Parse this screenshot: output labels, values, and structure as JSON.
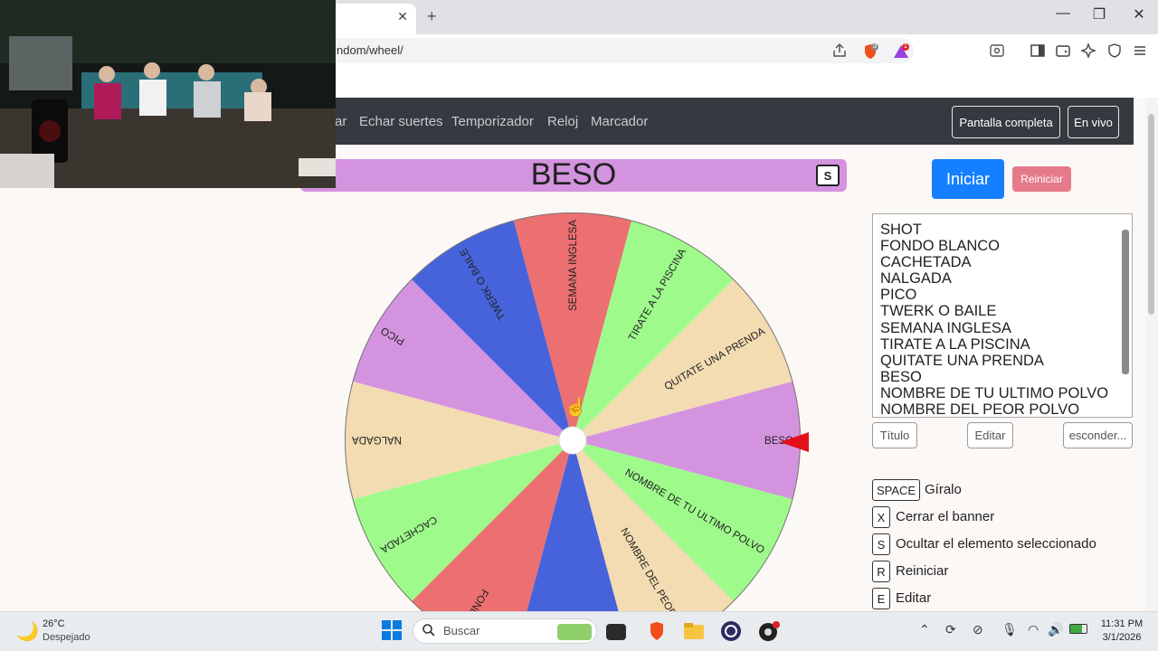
{
  "browser": {
    "url_fragment": "ndom/wheel/",
    "tab_close": "✕",
    "new_tab": "+",
    "window_controls": [
      "—",
      "❐",
      "✕"
    ],
    "toolbar_icons": [
      "share-icon",
      "brave-shield-icon",
      "brave-rewards-icon",
      "reader-mode-icon",
      "sidebar-icon",
      "wallet-icon",
      "leo-ai-icon",
      "vpn-icon",
      "menu-icon"
    ],
    "shield_badge": "3",
    "rewards_badge": "1"
  },
  "nav": {
    "links": [
      "ar",
      "Echar suertes",
      "Temporizador",
      "Reloj",
      "Marcador"
    ],
    "fullscreen_label": "Pantalla completa",
    "live_label": "En vivo"
  },
  "banner": {
    "title": "BESO",
    "s_key": "S"
  },
  "wheel": {
    "segments": [
      {
        "label": "SHOT",
        "color": "#4763dc"
      },
      {
        "label": "FONDO BLANCO",
        "color": "#ec7071"
      },
      {
        "label": "CACHETADA",
        "color": "#9efb8b"
      },
      {
        "label": "NALGADA",
        "color": "#f3dcb2"
      },
      {
        "label": "PICO",
        "color": "#d493df"
      },
      {
        "label": "TWERK O BAILE",
        "color": "#4763dc"
      },
      {
        "label": "SEMANA INGLESA",
        "color": "#ec7071"
      },
      {
        "label": "TIRATE A LA PISCINA",
        "color": "#9efb8b"
      },
      {
        "label": "QUITATE UNA PRENDA",
        "color": "#f3dcb2"
      },
      {
        "label": "BESO",
        "color": "#d493df"
      },
      {
        "label": "NOMBRE DE TU ULTIMO POLVO",
        "color": "#9efb8b"
      },
      {
        "label": "NOMBRE DEL PEOR POLVO",
        "color": "#f3dcb2"
      }
    ],
    "visible_labels": {
      "FONDO BLANCO": "FONDO B",
      "NOMBRE DEL PEOR POLVO": "NOMBRE DEL PEOR PO"
    }
  },
  "controls": {
    "start_label": "Iniciar",
    "reset_label": "Reiniciar",
    "title_label": "Título",
    "edit_label": "Editar",
    "hide_label": "esconder..."
  },
  "entries": [
    "SHOT",
    "FONDO BLANCO",
    "CACHETADA",
    "NALGADA",
    "PICO",
    "TWERK O BAILE",
    "SEMANA INGLESA",
    "TIRATE A LA PISCINA",
    "QUITATE UNA PRENDA",
    "BESO",
    "NOMBRE DE TU ULTIMO POLVO",
    "NOMBRE DEL PEOR POLVO"
  ],
  "shortcuts": [
    {
      "key": "SPACE",
      "label": "Gíralo"
    },
    {
      "key": "X",
      "label": "Cerrar el banner"
    },
    {
      "key": "S",
      "label": "Ocultar el elemento seleccionado"
    },
    {
      "key": "R",
      "label": "Reiniciar"
    },
    {
      "key": "E",
      "label": "Editar"
    }
  ],
  "taskbar": {
    "temperature": "26°C",
    "weather": "Despejado",
    "search_placeholder": "Buscar",
    "time": "11:31 PM",
    "date": "3/1/2026"
  }
}
